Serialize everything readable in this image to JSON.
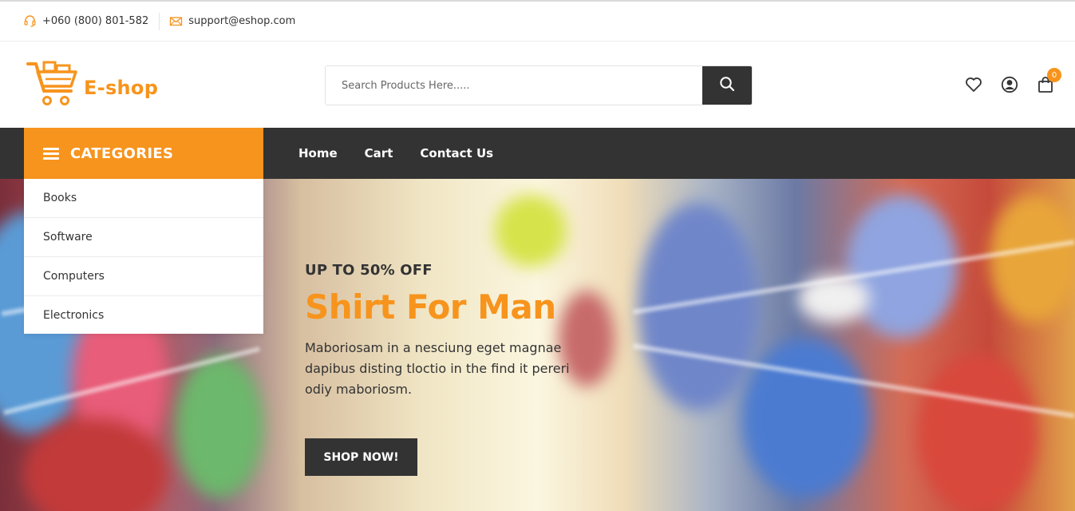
{
  "topbar": {
    "phone": "+060 (800) 801-582",
    "email": "support@eshop.com",
    "phone_icon": "headset-icon",
    "email_icon": "envelope-icon"
  },
  "header": {
    "logo_text": "E-shop",
    "logo_icon": "shopping-cart-icon",
    "search": {
      "placeholder": "Search Products Here.....",
      "value": ""
    },
    "cart_count": "0",
    "icons": [
      "heart-icon",
      "user-icon",
      "shopping-bag-icon"
    ]
  },
  "nav": {
    "categories_label": "CATEGORIES",
    "menu": [
      "Home",
      "Cart",
      "Contact Us"
    ]
  },
  "categories": [
    "Books",
    "Software",
    "Computers",
    "Electronics"
  ],
  "hero": {
    "promo": "UP TO 50% OFF",
    "title": "Shirt For Man",
    "description": "Maboriosam in a nesciung eget magnae dapibus disting tloctio in the find it pereri odiy maboriosm.",
    "button_label": "SHOP NOW!"
  },
  "colors": {
    "accent": "#f7941d",
    "dark": "#333333"
  }
}
